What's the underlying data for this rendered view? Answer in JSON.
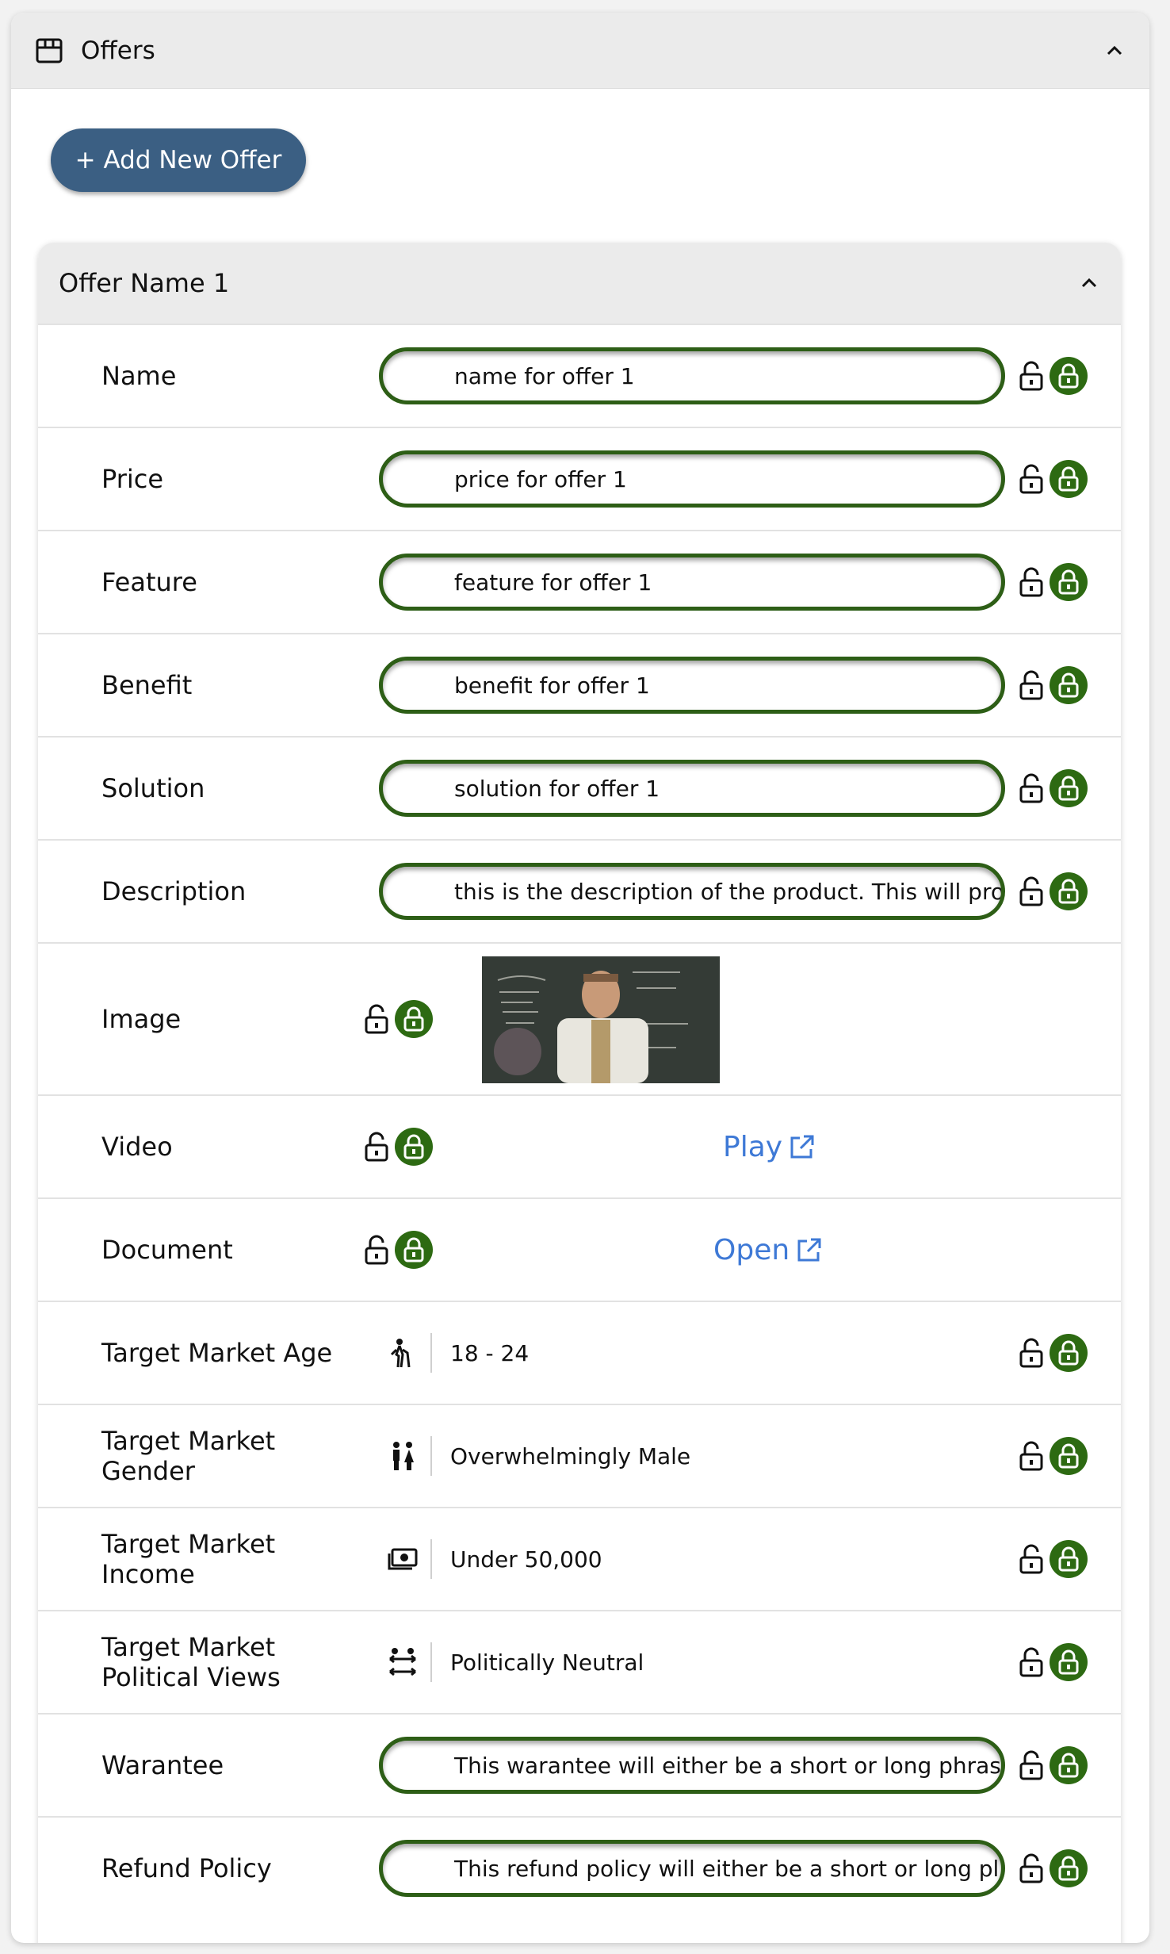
{
  "panel": {
    "title": "Offers",
    "icon": "store-icon"
  },
  "add_button": "+ Add New Offer",
  "offer": {
    "title": "Offer Name 1",
    "text_rows": [
      {
        "label": "Name",
        "value": "name for offer 1"
      },
      {
        "label": "Price",
        "value": "price for offer 1"
      },
      {
        "label": "Feature",
        "value": "feature for offer 1"
      },
      {
        "label": "Benefit",
        "value": "benefit for offer 1"
      },
      {
        "label": "Solution",
        "value": "solution for offer 1"
      },
      {
        "label": "Description",
        "value": "this is the description of the product. This will pro"
      }
    ],
    "image_row": {
      "label": "Image"
    },
    "video_row": {
      "label": "Video",
      "link": "Play"
    },
    "document_row": {
      "label": "Document",
      "link": "Open"
    },
    "target_rows": [
      {
        "label": "Target Market Age",
        "icon": "person-cane-icon",
        "value": "18 - 24"
      },
      {
        "label": "Target Market Gender",
        "icon": "people-gender-icon",
        "value": "Overwhelmingly Male"
      },
      {
        "label": "Target Market Income",
        "icon": "money-icon",
        "value": "Under 50,000"
      },
      {
        "label": "Target Market Political Views",
        "icon": "people-arrows-icon",
        "value": "Politically Neutral"
      }
    ],
    "bottom_rows": [
      {
        "label": "Warantee",
        "value": "This warantee will either be a short or long phras"
      },
      {
        "label": "Refund Policy",
        "value": "This refund policy will either be a short or long pl"
      }
    ]
  },
  "colors": {
    "accent_green": "#2d6a12",
    "button_blue": "#3b5f83",
    "link_blue": "#3e79d6"
  }
}
